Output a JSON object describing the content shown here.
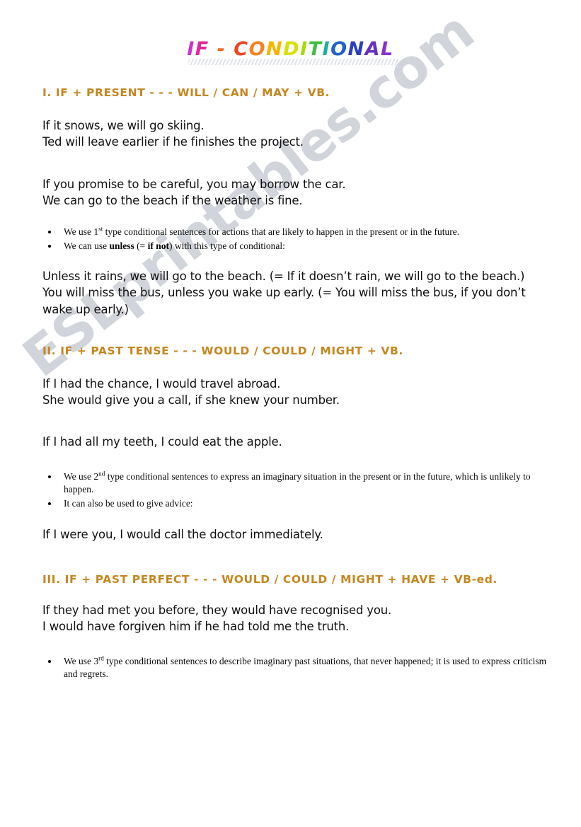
{
  "document": {
    "title_letters": [
      {
        "ch": "I",
        "color": "#cc33cc"
      },
      {
        "ch": "F",
        "color": "#e0289b"
      },
      {
        "ch": " ",
        "color": "#ffffff"
      },
      {
        "ch": "-",
        "color": "#f06a2a"
      },
      {
        "ch": " ",
        "color": "#ffffff"
      },
      {
        "ch": "C",
        "color": "#ee4422"
      },
      {
        "ch": "O",
        "color": "#f58220"
      },
      {
        "ch": "N",
        "color": "#f7b500"
      },
      {
        "ch": "D",
        "color": "#d8e000"
      },
      {
        "ch": "I",
        "color": "#a6d900"
      },
      {
        "ch": "T",
        "color": "#3fbf3f"
      },
      {
        "ch": "I",
        "color": "#17b0a0"
      },
      {
        "ch": "O",
        "color": "#1f63c8"
      },
      {
        "ch": "N",
        "color": "#2a3fc0"
      },
      {
        "ch": "A",
        "color": "#6a2fc0"
      },
      {
        "ch": "L",
        "color": "#8b2fc8"
      }
    ],
    "title_text": "IF - CONDITIONAL",
    "watermark": "ESLprintables.com",
    "accent_color": "#C5851F"
  },
  "section1": {
    "heading": "I.  IF   +   PRESENT   - - -   WILL / CAN / MAY   +   VB.",
    "examples_a": [
      "If it snows, we will go skiing.",
      "Ted will leave earlier if he finishes the project."
    ],
    "examples_b": [
      "If you promise to be careful, you may borrow the car.",
      "We can go to the beach if the weather is fine."
    ],
    "bullet1_pre": "We use 1",
    "bullet1_sup": "st",
    "bullet1_post": " type conditional sentences for actions that are likely to happen in the present or in the future.",
    "bullet2_pre": "We can use ",
    "bullet2_bold1": "unless",
    "bullet2_mid": " (= ",
    "bullet2_bold2": "if not",
    "bullet2_post": ") with this type of conditional:",
    "examples_c": [
      "Unless it rains, we will go to the beach. (= If it doesn’t rain, we will go to the beach.)",
      "You will miss the bus, unless you wake up early. (= You will miss the bus, if you don’t wake up early.)"
    ]
  },
  "section2": {
    "heading": "II. IF   +   PAST TENSE   - - -   WOULD / COULD / MIGHT   +   VB.",
    "examples_a": [
      "If I had the chance, I would travel abroad.",
      "She would give you a call, if she knew your number."
    ],
    "examples_b": [
      "If I had all my teeth, I could eat the apple."
    ],
    "bullet1_pre": "We use 2",
    "bullet1_sup": "nd",
    "bullet1_post": " type conditional sentences to express an imaginary situation in the present or in the future, which is unlikely to happen.",
    "bullet2": "It can also be used to give advice:",
    "examples_c": [
      "If I were you, I would call the doctor immediately."
    ]
  },
  "section3": {
    "heading": "III. IF + PAST PERFECT - - - WOULD / COULD / MIGHT + HAVE + VB-ed.",
    "examples_a": [
      "If they had met you before, they would have recognised you.",
      "I would have forgiven him if he had told me the truth."
    ],
    "bullet1_pre": "We use 3",
    "bullet1_sup": "rd",
    "bullet1_post": " type conditional sentences to describe imaginary past situations, that never happened; it is used to express criticism and regrets."
  }
}
